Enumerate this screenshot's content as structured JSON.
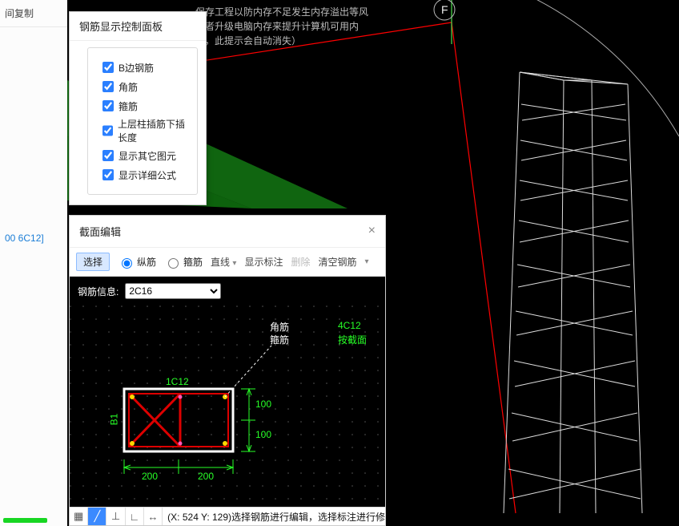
{
  "left": {
    "tab1": "间复制",
    "code": "00 6C12]"
  },
  "rebar_panel": {
    "title": "钢筋显示控制面板",
    "items": [
      "B边钢筋",
      "角筋",
      "箍筋",
      "上层柱插筋下插长度",
      "显示其它图元",
      "显示详细公式"
    ]
  },
  "section_panel": {
    "title": "截面编辑",
    "close": "×",
    "toolbar": {
      "select": "选择",
      "long": "纵筋",
      "stirrup": "箍筋",
      "line": "直线",
      "show_label": "显示标注",
      "delete": "删除",
      "clear": "清空钢筋"
    },
    "info_label": "钢筋信息:",
    "info_value": "2C16",
    "annotations": {
      "corner": "角筋",
      "stirrup_lbl": "箍筋",
      "right1": "4C12",
      "right2": "按截面",
      "top_dim": "1C12",
      "left_label": "B1",
      "d_100a": "100",
      "d_100b": "100",
      "d_200a": "200",
      "d_200b": "200"
    },
    "status": "(X: 524 Y: 129)选择钢筋进行编辑，选择标注进行修"
  },
  "viewport": {
    "hint_l1": "保存工程以防内存不足发生内存溢出等风",
    "hint_l2": "或者升级电脑内存来提升计算机可用内",
    "hint_l3": "时，此提示会自动消失）",
    "axis_F": "F"
  }
}
